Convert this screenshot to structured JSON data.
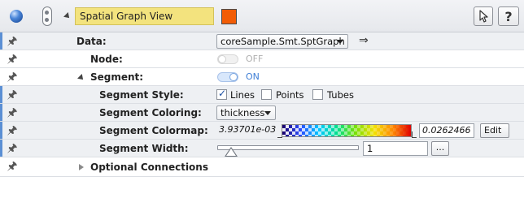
{
  "header": {
    "title": "Spatial Graph View",
    "swatch_color": "#f25c05",
    "help_label": "?"
  },
  "rows": {
    "data": {
      "label": "Data:",
      "value": "coreSample.Smt.SptGraph"
    },
    "node": {
      "label": "Node:",
      "state": "OFF"
    },
    "segment": {
      "label": "Segment:",
      "state": "ON"
    },
    "segment_style": {
      "label": "Segment Style:",
      "options": [
        {
          "label": "Lines",
          "checked": true
        },
        {
          "label": "Points",
          "checked": false
        },
        {
          "label": "Tubes",
          "checked": false
        }
      ]
    },
    "segment_coloring": {
      "label": "Segment Coloring:",
      "value": "thickness"
    },
    "segment_colormap": {
      "label": "Segment Colormap:",
      "min": "3.93701e-03",
      "max": "0.0262466",
      "edit_label": "Edit"
    },
    "segment_width": {
      "label": "Segment Width:",
      "value": "1",
      "more_label": "..."
    },
    "optional_connections": {
      "label": "Optional Connections"
    }
  }
}
